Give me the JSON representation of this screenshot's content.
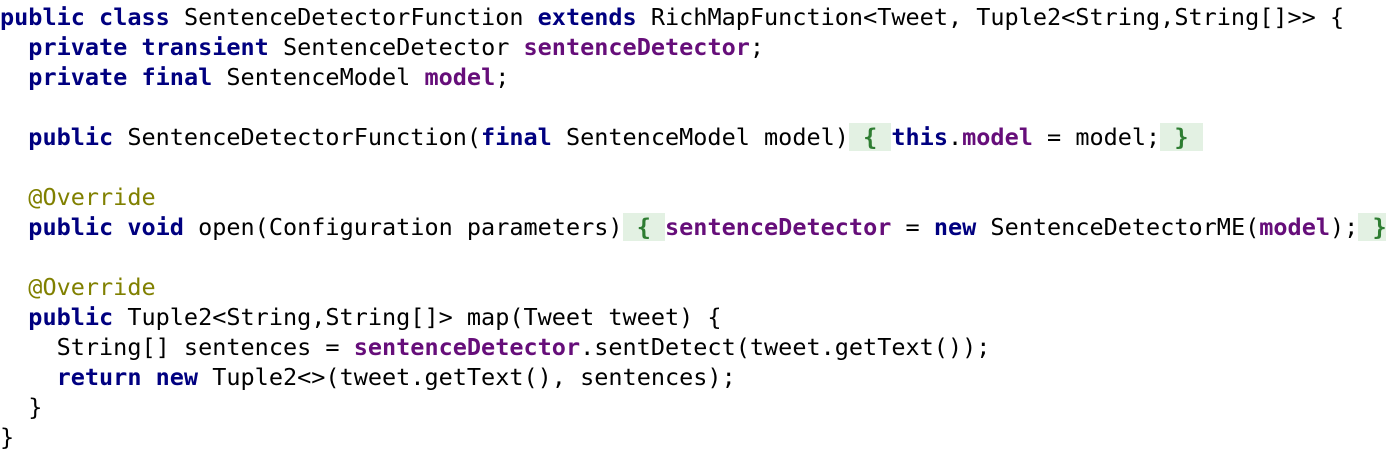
{
  "lines": [
    [
      {
        "t": "public",
        "c": "kw"
      },
      {
        "t": " "
      },
      {
        "t": "class",
        "c": "kw"
      },
      {
        "t": " SentenceDetectorFunction "
      },
      {
        "t": "extends",
        "c": "kw"
      },
      {
        "t": " RichMapFunction<Tweet, Tuple2<String,String[]>> {"
      }
    ],
    [
      {
        "t": "  "
      },
      {
        "t": "private",
        "c": "kw"
      },
      {
        "t": " "
      },
      {
        "t": "transient",
        "c": "kw"
      },
      {
        "t": " SentenceDetector "
      },
      {
        "t": "sentenceDetector",
        "c": "field"
      },
      {
        "t": ";"
      }
    ],
    [
      {
        "t": "  "
      },
      {
        "t": "private",
        "c": "kw"
      },
      {
        "t": " "
      },
      {
        "t": "final",
        "c": "kw"
      },
      {
        "t": " SentenceModel "
      },
      {
        "t": "model",
        "c": "field"
      },
      {
        "t": ";"
      }
    ],
    [],
    [
      {
        "t": "  "
      },
      {
        "t": "public",
        "c": "kw"
      },
      {
        "t": " SentenceDetectorFunction("
      },
      {
        "t": "final",
        "c": "kw"
      },
      {
        "t": " SentenceModel model)"
      },
      {
        "t": " { ",
        "c": "fold-open"
      },
      {
        "t": "this",
        "c": "kw"
      },
      {
        "t": "."
      },
      {
        "t": "model",
        "c": "field"
      },
      {
        "t": " = model;"
      },
      {
        "t": " } ",
        "c": "fold-close"
      }
    ],
    [],
    [
      {
        "t": "  "
      },
      {
        "t": "@Override",
        "c": "ann"
      }
    ],
    [
      {
        "t": "  "
      },
      {
        "t": "public",
        "c": "kw"
      },
      {
        "t": " "
      },
      {
        "t": "void",
        "c": "kw"
      },
      {
        "t": " open(Configuration parameters)"
      },
      {
        "t": " { ",
        "c": "fold-open"
      },
      {
        "t": "sentenceDetector",
        "c": "field"
      },
      {
        "t": " = "
      },
      {
        "t": "new",
        "c": "kw"
      },
      {
        "t": " SentenceDetectorME("
      },
      {
        "t": "model",
        "c": "field"
      },
      {
        "t": ");"
      },
      {
        "t": " } ",
        "c": "fold-close"
      }
    ],
    [],
    [
      {
        "t": "  "
      },
      {
        "t": "@Override",
        "c": "ann"
      }
    ],
    [
      {
        "t": "  "
      },
      {
        "t": "public",
        "c": "kw"
      },
      {
        "t": " Tuple2<String,String[]> map(Tweet tweet) {"
      }
    ],
    [
      {
        "t": "    String[] sentences = "
      },
      {
        "t": "sentenceDetector",
        "c": "field"
      },
      {
        "t": ".sentDetect(tweet.getText());"
      }
    ],
    [
      {
        "t": "    "
      },
      {
        "t": "return",
        "c": "kw"
      },
      {
        "t": " "
      },
      {
        "t": "new",
        "c": "kw"
      },
      {
        "t": " Tuple2<>(tweet.getText(), sentences);"
      }
    ],
    [
      {
        "t": "  }"
      }
    ],
    [
      {
        "t": "}"
      }
    ]
  ]
}
